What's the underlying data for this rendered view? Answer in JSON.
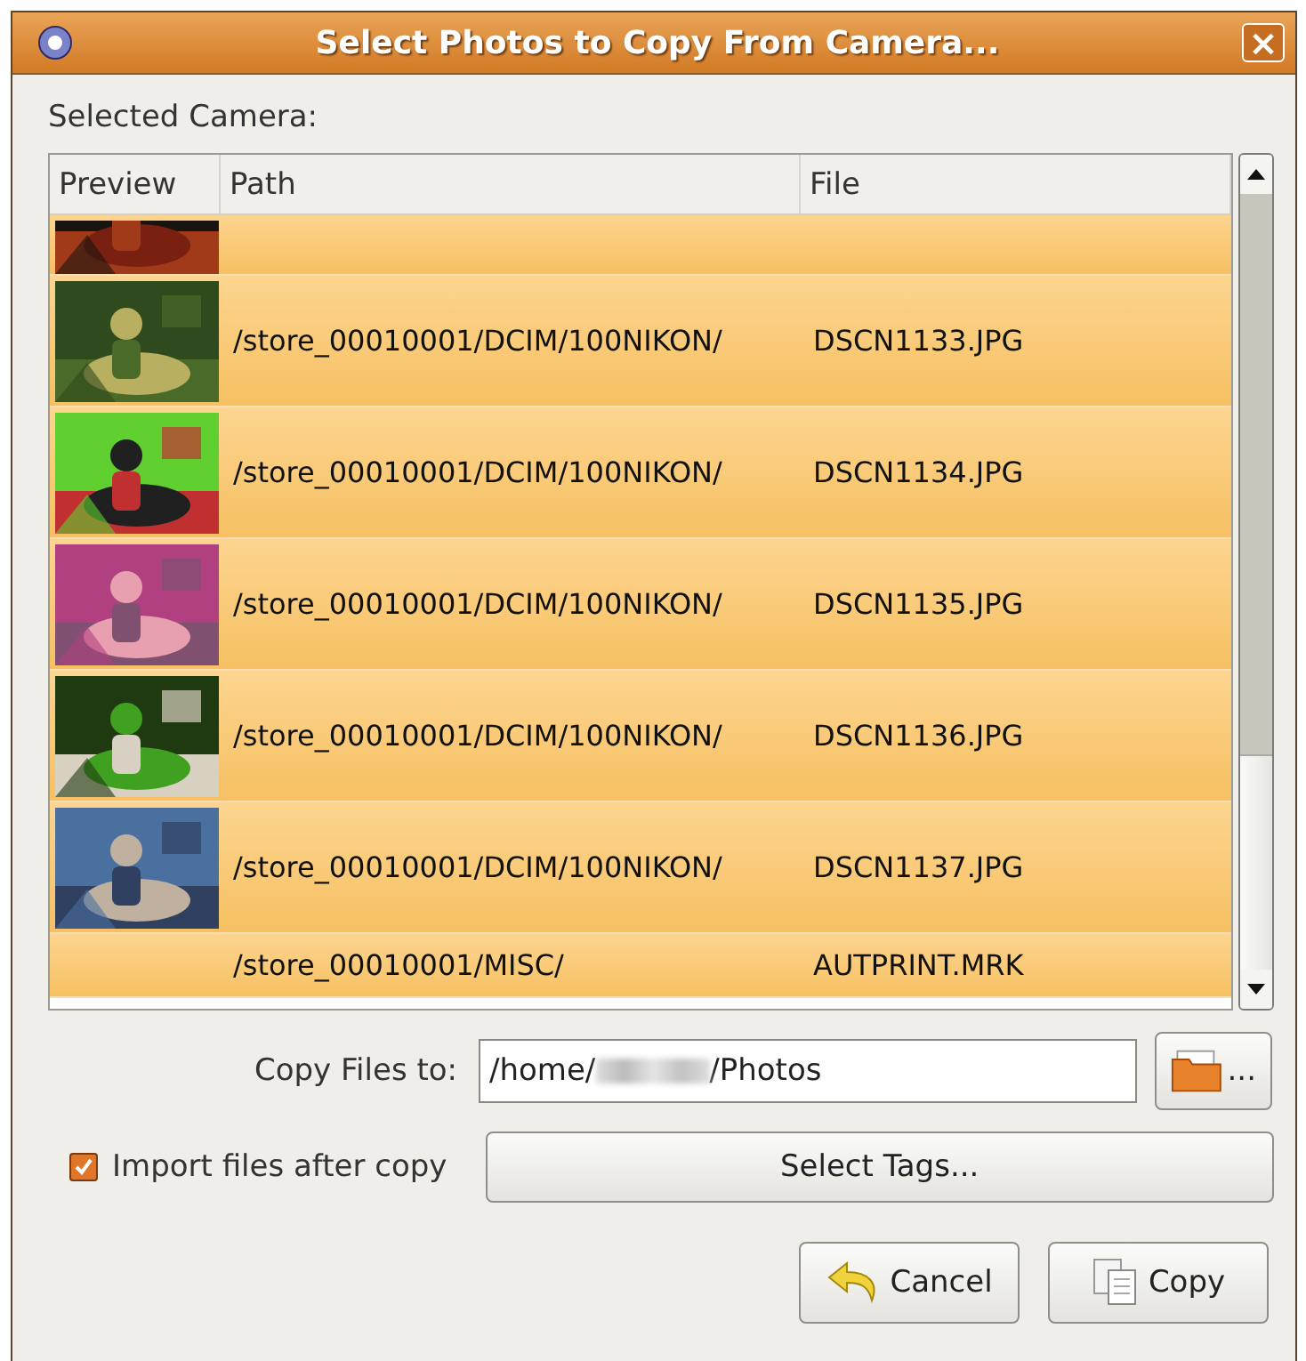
{
  "window": {
    "title": "Select Photos to Copy From Camera...",
    "close_icon": "×"
  },
  "camera_label": "Selected Camera:",
  "table": {
    "columns": [
      "Preview",
      "Path",
      "File"
    ],
    "rows": [
      {
        "kind": "partial",
        "selected": true
      },
      {
        "path": "/store_00010001/DCIM/100NIKON/",
        "file": "DSCN1133.JPG",
        "selected": true
      },
      {
        "path": "/store_00010001/DCIM/100NIKON/",
        "file": "DSCN1134.JPG",
        "selected": true
      },
      {
        "path": "/store_00010001/DCIM/100NIKON/",
        "file": "DSCN1135.JPG",
        "selected": true
      },
      {
        "path": "/store_00010001/DCIM/100NIKON/",
        "file": "DSCN1136.JPG",
        "selected": true
      },
      {
        "path": "/store_00010001/DCIM/100NIKON/",
        "file": "DSCN1137.JPG",
        "selected": true
      },
      {
        "kind": "file",
        "path": "/store_00010001/MISC/",
        "file": "AUTPRINT.MRK",
        "selected": true
      }
    ]
  },
  "copy_to": {
    "label": "Copy Files to:",
    "value_parts": [
      "/home/",
      "/Photos"
    ],
    "redacted": true,
    "browse_button": "..."
  },
  "import_after_copy": {
    "label": "Import files after copy",
    "checked": true
  },
  "select_tags_button": "Select Tags...",
  "buttons": [
    {
      "kind": "cancel",
      "label": "Cancel"
    },
    {
      "kind": "copy",
      "label": "Copy"
    }
  ]
}
